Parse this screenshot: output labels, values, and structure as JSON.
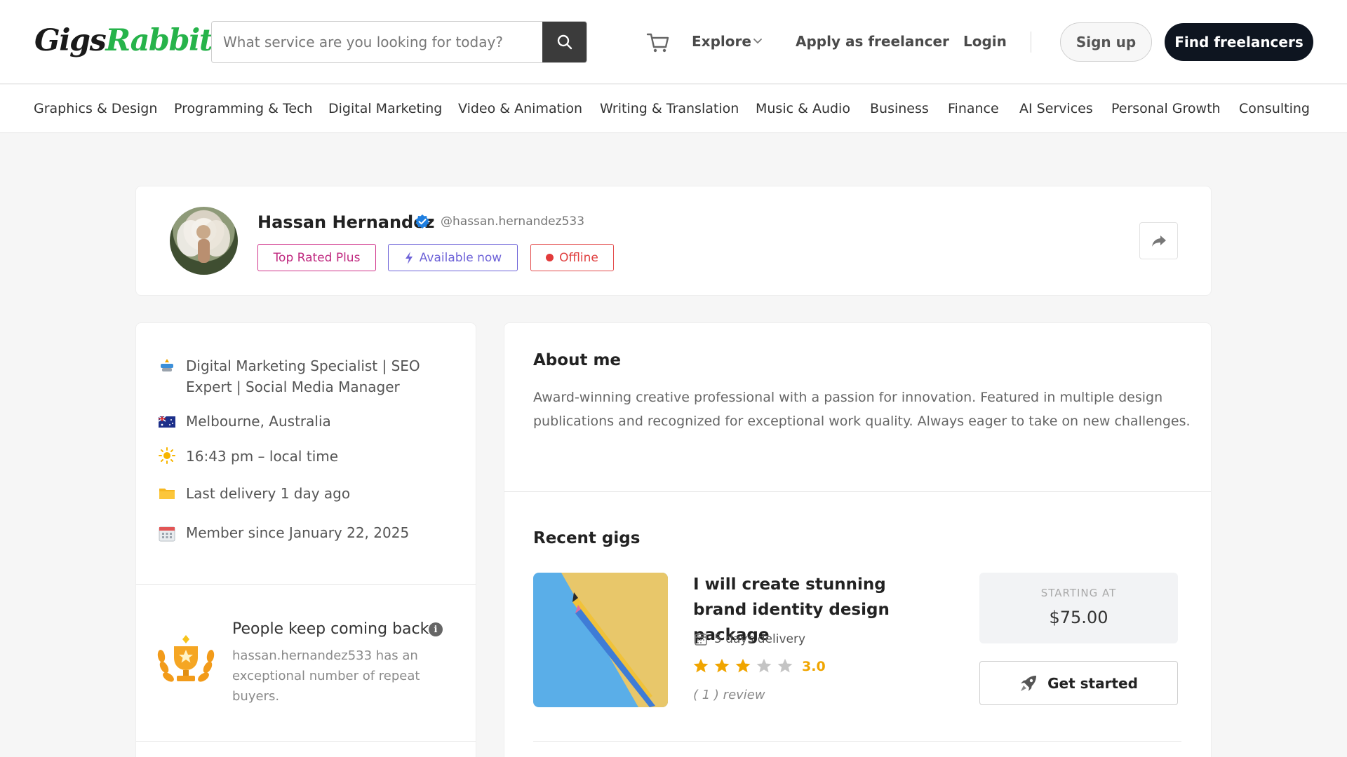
{
  "header": {
    "logo_part1": "Gigs",
    "logo_part2": "Rabbit",
    "search_placeholder": "What service are you looking for today?",
    "nav": {
      "explore": "Explore",
      "apply": "Apply as freelancer",
      "login": "Login"
    },
    "signup": "Sign up",
    "find_freelancers": "Find freelancers"
  },
  "categories": [
    "Graphics & Design",
    "Programming & Tech",
    "Digital Marketing",
    "Video & Animation",
    "Writing & Translation",
    "Music & Audio",
    "Business",
    "Finance",
    "AI Services",
    "Personal Growth",
    "Consulting"
  ],
  "profile": {
    "name": "Hassan Hernandez",
    "handle": "@hassan.hernandez533",
    "badges": {
      "top_rated": "Top Rated Plus",
      "available": "Available now",
      "offline": "Offline"
    }
  },
  "info": {
    "title_line1": "Digital Marketing Specialist | SEO",
    "title_line2": "Expert | Social Media Manager",
    "location": "Melbourne,  Australia",
    "local_time": "16:43 pm – local time",
    "last_delivery": "Last delivery 1 day ago",
    "member_since": "Member since January 22, 2025"
  },
  "repeat": {
    "title": "People keep coming back",
    "desc": "hassan.hernandez533 has an exceptional number of repeat buyers."
  },
  "about": {
    "title": "About me",
    "text": "Award-winning creative professional with a passion for innovation. Featured in multiple design publications and recognized for exceptional work quality. Always eager to take on new challenges."
  },
  "recent": {
    "title": "Recent gigs",
    "gig": {
      "title": "I will create stunning brand identity design package",
      "delivery": "5 days delivery",
      "rating": "3.0",
      "rating_value": 3,
      "rating_max": 5,
      "reviews": "( 1 ) review",
      "starting_label": "STARTING AT",
      "price": "$75.00",
      "cta": "Get started"
    }
  },
  "colors": {
    "brand_green": "#26b34a",
    "dark": "#0e1520",
    "star": "#f0a500"
  }
}
